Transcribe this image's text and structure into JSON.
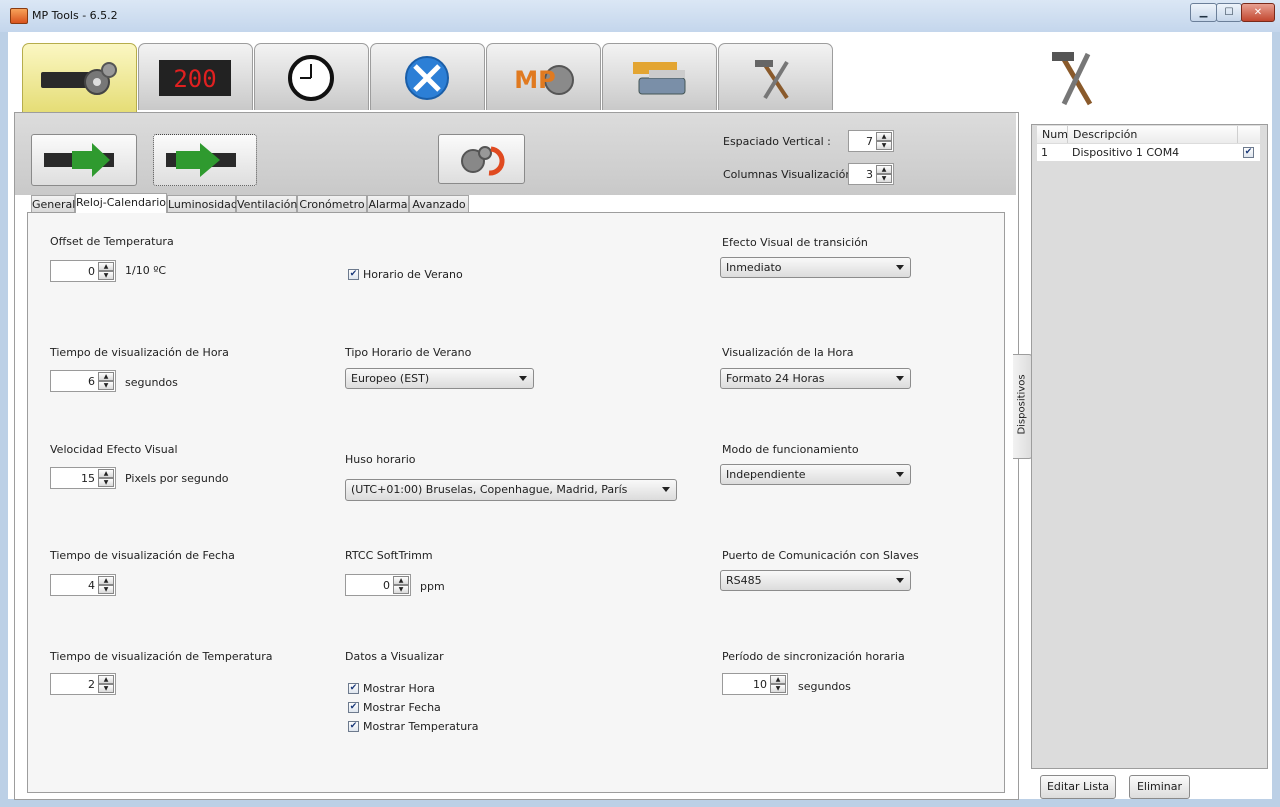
{
  "window": {
    "title": "MP Tools - 6.5.2",
    "minimize": "▁",
    "maximize": "☐",
    "close": "✕"
  },
  "top_tabs": [
    {
      "name": "display-config",
      "icon": "led-panel-gears-icon",
      "active": true
    },
    {
      "name": "led-display",
      "icon": "led-digits-icon",
      "active": false
    },
    {
      "name": "clock",
      "icon": "clock-icon",
      "active": false
    },
    {
      "name": "tools",
      "icon": "wrench-screwdriver-icon",
      "active": false
    },
    {
      "name": "mp-tools",
      "icon": "mp-tools-logo-icon",
      "active": false
    },
    {
      "name": "connection",
      "icon": "serial-cable-icon",
      "active": false
    },
    {
      "name": "hammer-tools",
      "icon": "hammer-wrench-icon",
      "active": false
    }
  ],
  "toolbar": {
    "vertical_spacing_label": "Espaciado Vertical :",
    "vertical_spacing_value": "7",
    "columns_label": "Columnas Visualización :",
    "columns_value": "3"
  },
  "sub_tabs": [
    "General",
    "Reloj-Calendario",
    "Luminosidad",
    "Ventilación",
    "Cronómetro",
    "Alarma",
    "Avanzado"
  ],
  "form": {
    "temp_offset_label": "Offset de Temperatura",
    "temp_offset_value": "0",
    "temp_offset_unit": "1/10 ºC",
    "dst_label": "Horario de Verano",
    "transition_label": "Efecto Visual de transición",
    "transition_value": "Inmediato",
    "hour_time_label": "Tiempo de visualización de Hora",
    "hour_time_value": "6",
    "hour_time_unit": "segundos",
    "dst_type_label": "Tipo Horario de Verano",
    "dst_type_value": "Europeo (EST)",
    "hour_display_label": "Visualización de la Hora",
    "hour_display_value": "Formato 24 Horas",
    "effect_speed_label": "Velocidad Efecto Visual",
    "effect_speed_value": "15",
    "effect_speed_unit": "Pixels por segundo",
    "timezone_label": "Huso horario",
    "timezone_value": "(UTC+01:00) Bruselas, Copenhague, Madrid, París",
    "mode_label": "Modo de funcionamiento",
    "mode_value": "Independiente",
    "date_time_label": "Tiempo de visualización de Fecha",
    "date_time_value": "4",
    "rtcc_label": "RTCC SoftTrimm",
    "rtcc_value": "0",
    "rtcc_unit": "ppm",
    "slave_port_label": "Puerto de Comunicación con Slaves",
    "slave_port_value": "RS485",
    "temp_time_label": "Tiempo de visualización de Temperatura",
    "temp_time_value": "2",
    "data_label": "Datos a Visualizar",
    "show_hour": "Mostrar Hora",
    "show_date": "Mostrar Fecha",
    "show_temp": "Mostrar Temperatura",
    "sync_label": "Período de sincronización horaria",
    "sync_value": "10",
    "sync_unit": "segundos"
  },
  "devices": {
    "side_tab": "Dispositivos",
    "col_num": "Num",
    "col_desc": "Descripción",
    "rows": [
      {
        "num": "1",
        "desc": "Dispositivo 1 COM4",
        "checked": true
      }
    ],
    "edit_button": "Editar Lista",
    "delete_button": "Eliminar"
  },
  "colors": {
    "active_tab": "#e5dd76",
    "arrow_green": "#2f9a2f",
    "led_red": "#e02020"
  }
}
